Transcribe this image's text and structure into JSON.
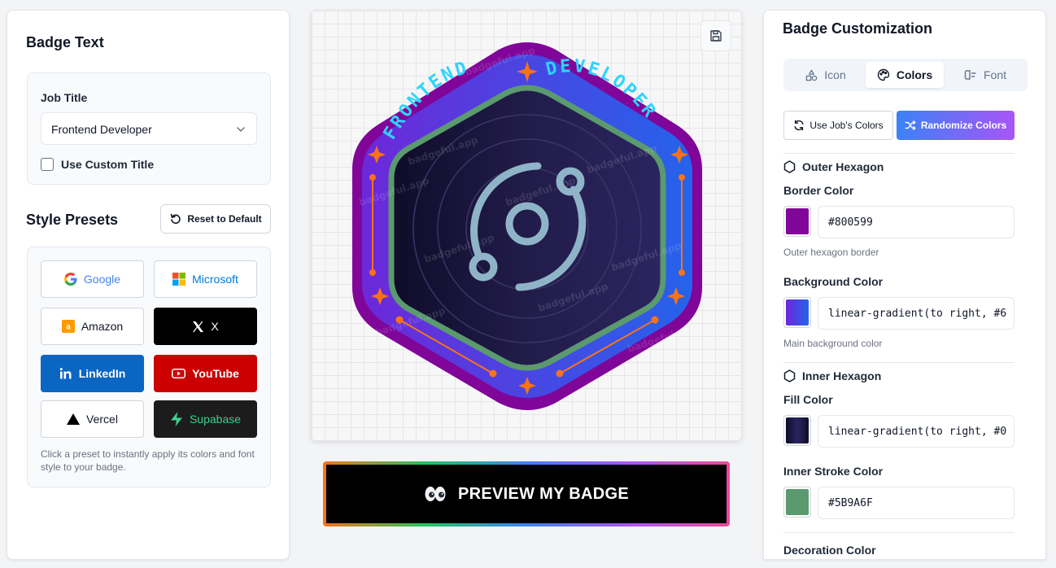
{
  "left": {
    "badge_text_title": "Badge Text",
    "job_title_label": "Job Title",
    "job_title_value": "Frontend Developer",
    "custom_title_label": "Use Custom Title",
    "style_presets_title": "Style Presets",
    "reset_label": "Reset to Default",
    "presets": [
      {
        "label": "Google",
        "icon": "google-icon",
        "bg": "#ffffff",
        "color": "#4285f4"
      },
      {
        "label": "Microsoft",
        "icon": "microsoft-icon",
        "bg": "#ffffff",
        "color": "#0078d4"
      },
      {
        "label": "Amazon",
        "icon": "amazon-icon",
        "bg": "#ffffff",
        "color": "#111827"
      },
      {
        "label": "X",
        "icon": "x-icon",
        "bg": "#000000",
        "color": "#ffffff"
      },
      {
        "label": "LinkedIn",
        "icon": "linkedin-icon",
        "bg": "#0a66c2",
        "color": "#ffffff"
      },
      {
        "label": "YouTube",
        "icon": "youtube-icon",
        "bg": "#cc0000",
        "color": "#ffffff"
      },
      {
        "label": "Vercel",
        "icon": "vercel-icon",
        "bg": "#ffffff",
        "color": "#111827"
      },
      {
        "label": "Supabase",
        "icon": "supabase-icon",
        "bg": "#1c1c1c",
        "color": "#3ecf8e"
      }
    ],
    "presets_hint": "Click a preset to instantly apply its colors and font style to your badge."
  },
  "badge": {
    "top_text_left": "FRONTEND",
    "top_text_right": "DEVELOPER",
    "watermark": "badgeful.app",
    "outer_border": "#800599",
    "inner_stroke": "#5B9A6F",
    "icon_color": "#8fb4c8",
    "decoration_color": "#f97316"
  },
  "preview_label": "PREVIEW MY BADGE",
  "right": {
    "title": "Badge Customization",
    "tabs": [
      {
        "label": "Icon",
        "icon": "shapes-icon",
        "active": false
      },
      {
        "label": "Colors",
        "icon": "palette-icon",
        "active": true
      },
      {
        "label": "Font",
        "icon": "font-icon",
        "active": false
      }
    ],
    "job_colors_label": "Use Job's Colors",
    "randomize_label": "Randomize Colors",
    "outer_hexagon_title": "Outer Hexagon",
    "border_color_label": "Border Color",
    "border_color_value": "#800599",
    "border_color_help": "Outer hexagon border",
    "bg_color_label": "Background Color",
    "bg_color_value": "linear-gradient(to right, #6",
    "bg_color_help": "Main background color",
    "inner_hexagon_title": "Inner Hexagon",
    "fill_color_label": "Fill Color",
    "fill_color_value": "linear-gradient(to right, #0",
    "stroke_color_label": "Inner Stroke Color",
    "stroke_color_value": "#5B9A6F",
    "decoration_color_label": "Decoration Color"
  }
}
